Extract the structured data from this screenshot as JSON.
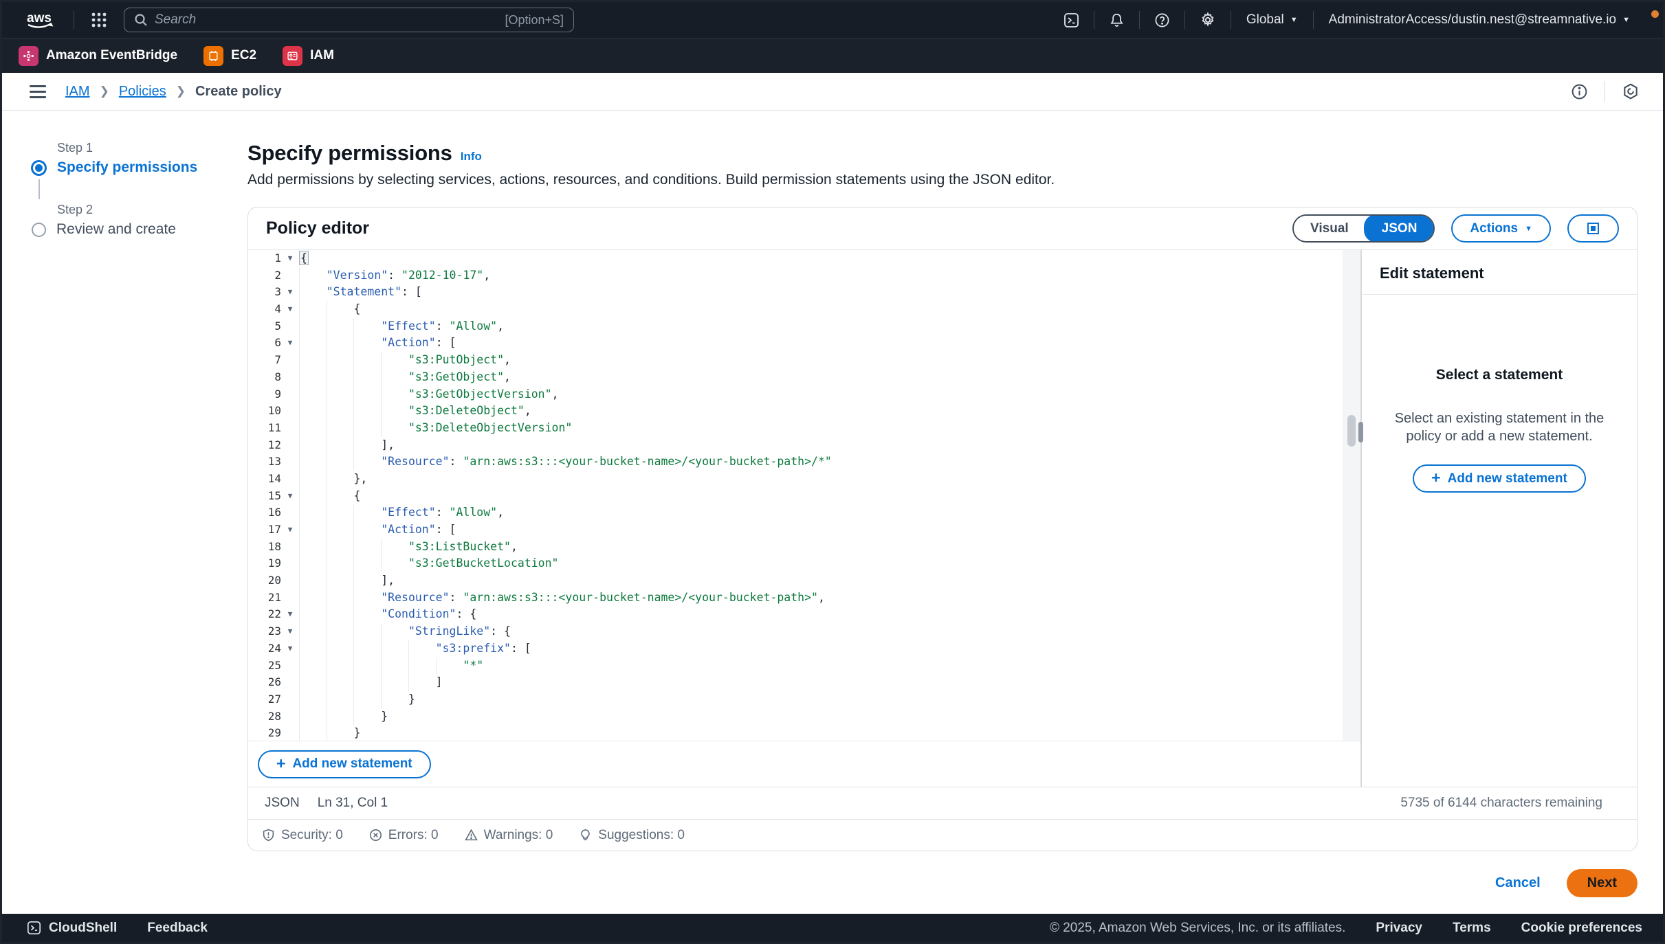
{
  "topbar": {
    "logo": "aws",
    "search_placeholder": "Search",
    "search_shortcut": "[Option+S]",
    "region": "Global",
    "account": "AdministratorAccess/dustin.nest@streamnative.io"
  },
  "favorites": [
    {
      "label": "Amazon EventBridge",
      "color": "#c7366f",
      "glyph": "eventbridge-icon"
    },
    {
      "label": "EC2",
      "color": "#ed7100",
      "glyph": "ec2-icon"
    },
    {
      "label": "IAM",
      "color": "#dd3448",
      "glyph": "iam-icon"
    }
  ],
  "breadcrumb": {
    "items": [
      {
        "label": "IAM",
        "link": true
      },
      {
        "label": "Policies",
        "link": true
      },
      {
        "label": "Create policy",
        "link": false
      }
    ]
  },
  "steps": [
    {
      "step": "Step 1",
      "label": "Specify permissions",
      "active": true
    },
    {
      "step": "Step 2",
      "label": "Review and create",
      "active": false
    }
  ],
  "page": {
    "title": "Specify permissions",
    "info_label": "Info",
    "description": "Add permissions by selecting services, actions, resources, and conditions. Build permission statements using the JSON editor."
  },
  "policy_editor": {
    "title": "Policy editor",
    "visual_label": "Visual",
    "json_label": "JSON",
    "active_tab": "JSON",
    "actions_label": "Actions",
    "add_statement_label": "Add new statement",
    "status_mode": "JSON",
    "cursor_position": "Ln 31, Col 1",
    "characters_remaining": "5735 of 6144 characters remaining",
    "checks": [
      {
        "icon": "shield-icon",
        "label": "Security",
        "count": "0"
      },
      {
        "icon": "error-icon",
        "label": "Errors",
        "count": "0"
      },
      {
        "icon": "warning-icon",
        "label": "Warnings",
        "count": "0"
      },
      {
        "icon": "suggestion-icon",
        "label": "Suggestions",
        "count": "0"
      }
    ],
    "lines": [
      {
        "n": "1",
        "ind": 0,
        "fold": true,
        "tokens": [
          [
            "hl",
            "{"
          ]
        ]
      },
      {
        "n": "2",
        "ind": 1,
        "fold": false,
        "tokens": [
          [
            "k",
            "\"Version\""
          ],
          [
            "p",
            ": "
          ],
          [
            "s",
            "\"2012-10-17\""
          ],
          [
            "p",
            ","
          ]
        ]
      },
      {
        "n": "3",
        "ind": 1,
        "fold": true,
        "tokens": [
          [
            "k",
            "\"Statement\""
          ],
          [
            "p",
            ": ["
          ]
        ]
      },
      {
        "n": "4",
        "ind": 2,
        "fold": true,
        "tokens": [
          [
            "p",
            "{"
          ]
        ]
      },
      {
        "n": "5",
        "ind": 3,
        "fold": false,
        "tokens": [
          [
            "k",
            "\"Effect\""
          ],
          [
            "p",
            ": "
          ],
          [
            "s",
            "\"Allow\""
          ],
          [
            "p",
            ","
          ]
        ]
      },
      {
        "n": "6",
        "ind": 3,
        "fold": true,
        "tokens": [
          [
            "k",
            "\"Action\""
          ],
          [
            "p",
            ": ["
          ]
        ]
      },
      {
        "n": "7",
        "ind": 4,
        "fold": false,
        "tokens": [
          [
            "s",
            "\"s3:PutObject\""
          ],
          [
            "p",
            ","
          ]
        ]
      },
      {
        "n": "8",
        "ind": 4,
        "fold": false,
        "tokens": [
          [
            "s",
            "\"s3:GetObject\""
          ],
          [
            "p",
            ","
          ]
        ]
      },
      {
        "n": "9",
        "ind": 4,
        "fold": false,
        "tokens": [
          [
            "s",
            "\"s3:GetObjectVersion\""
          ],
          [
            "p",
            ","
          ]
        ]
      },
      {
        "n": "10",
        "ind": 4,
        "fold": false,
        "tokens": [
          [
            "s",
            "\"s3:DeleteObject\""
          ],
          [
            "p",
            ","
          ]
        ]
      },
      {
        "n": "11",
        "ind": 4,
        "fold": false,
        "tokens": [
          [
            "s",
            "\"s3:DeleteObjectVersion\""
          ]
        ]
      },
      {
        "n": "12",
        "ind": 3,
        "fold": false,
        "tokens": [
          [
            "p",
            "],"
          ]
        ]
      },
      {
        "n": "13",
        "ind": 3,
        "fold": false,
        "tokens": [
          [
            "k",
            "\"Resource\""
          ],
          [
            "p",
            ": "
          ],
          [
            "s",
            "\"arn:aws:s3:::<your-bucket-name>/<your-bucket-path>/*\""
          ]
        ]
      },
      {
        "n": "14",
        "ind": 2,
        "fold": false,
        "tokens": [
          [
            "p",
            "},"
          ]
        ]
      },
      {
        "n": "15",
        "ind": 2,
        "fold": true,
        "tokens": [
          [
            "p",
            "{"
          ]
        ]
      },
      {
        "n": "16",
        "ind": 3,
        "fold": false,
        "tokens": [
          [
            "k",
            "\"Effect\""
          ],
          [
            "p",
            ": "
          ],
          [
            "s",
            "\"Allow\""
          ],
          [
            "p",
            ","
          ]
        ]
      },
      {
        "n": "17",
        "ind": 3,
        "fold": true,
        "tokens": [
          [
            "k",
            "\"Action\""
          ],
          [
            "p",
            ": ["
          ]
        ]
      },
      {
        "n": "18",
        "ind": 4,
        "fold": false,
        "tokens": [
          [
            "s",
            "\"s3:ListBucket\""
          ],
          [
            "p",
            ","
          ]
        ]
      },
      {
        "n": "19",
        "ind": 4,
        "fold": false,
        "tokens": [
          [
            "s",
            "\"s3:GetBucketLocation\""
          ]
        ]
      },
      {
        "n": "20",
        "ind": 3,
        "fold": false,
        "tokens": [
          [
            "p",
            "],"
          ]
        ]
      },
      {
        "n": "21",
        "ind": 3,
        "fold": false,
        "tokens": [
          [
            "k",
            "\"Resource\""
          ],
          [
            "p",
            ": "
          ],
          [
            "s",
            "\"arn:aws:s3:::<your-bucket-name>/<your-bucket-path>\""
          ],
          [
            "p",
            ","
          ]
        ]
      },
      {
        "n": "22",
        "ind": 3,
        "fold": true,
        "tokens": [
          [
            "k",
            "\"Condition\""
          ],
          [
            "p",
            ": {"
          ]
        ]
      },
      {
        "n": "23",
        "ind": 4,
        "fold": true,
        "tokens": [
          [
            "k",
            "\"StringLike\""
          ],
          [
            "p",
            ": {"
          ]
        ]
      },
      {
        "n": "24",
        "ind": 5,
        "fold": true,
        "tokens": [
          [
            "k",
            "\"s3:prefix\""
          ],
          [
            "p",
            ": ["
          ]
        ]
      },
      {
        "n": "25",
        "ind": 6,
        "fold": false,
        "tokens": [
          [
            "s",
            "\"*\""
          ]
        ]
      },
      {
        "n": "26",
        "ind": 5,
        "fold": false,
        "tokens": [
          [
            "p",
            "]"
          ]
        ]
      },
      {
        "n": "27",
        "ind": 4,
        "fold": false,
        "tokens": [
          [
            "p",
            "}"
          ]
        ]
      },
      {
        "n": "28",
        "ind": 3,
        "fold": false,
        "tokens": [
          [
            "p",
            "}"
          ]
        ]
      },
      {
        "n": "29",
        "ind": 2,
        "fold": false,
        "tokens": [
          [
            "p",
            "}"
          ]
        ]
      }
    ]
  },
  "side_panel": {
    "title": "Edit statement",
    "empty_title": "Select a statement",
    "empty_text": "Select an existing statement in the policy or add a new statement.",
    "add_statement_label": "Add new statement"
  },
  "form_actions": {
    "cancel": "Cancel",
    "next": "Next"
  },
  "footer": {
    "cloudshell": "CloudShell",
    "feedback": "Feedback",
    "copyright": "© 2025, Amazon Web Services, Inc. or its affiliates.",
    "links": [
      "Privacy",
      "Terms",
      "Cookie preferences"
    ]
  },
  "colors": {
    "accent": "#0972d3",
    "primary_button": "#ec7211",
    "dark_header": "#161d26",
    "code_key": "#2a5db0",
    "code_string": "#0e7a3e"
  }
}
